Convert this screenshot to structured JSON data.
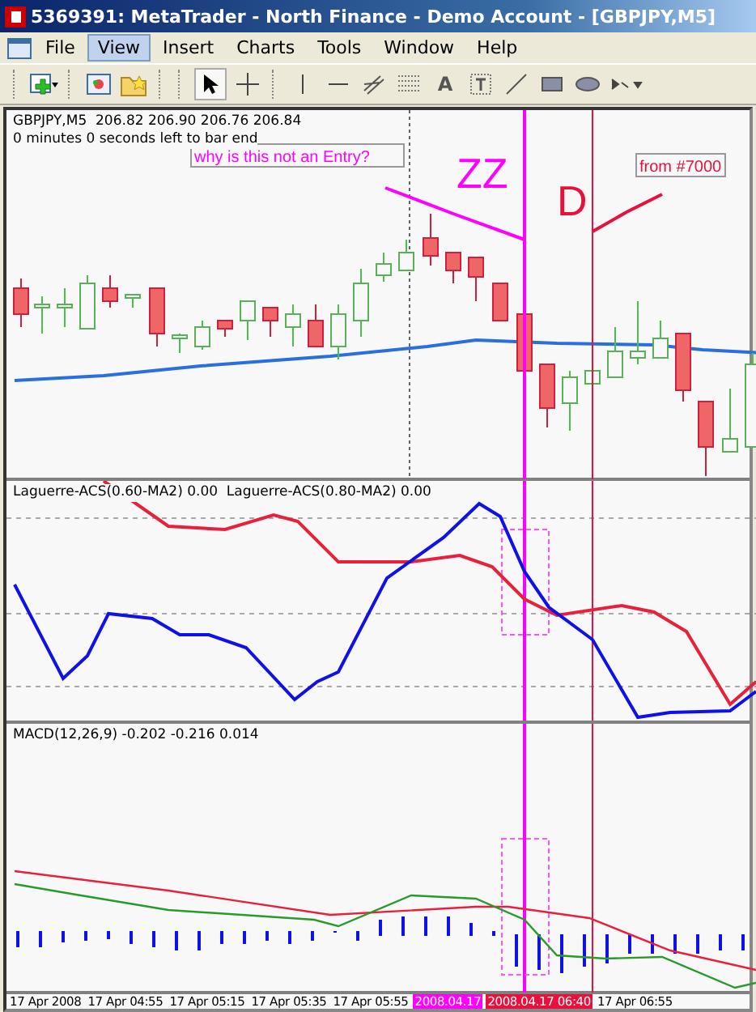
{
  "window": {
    "title": "5369391: MetaTrader - North Finance - Demo Account - [GBPJPY,M5]"
  },
  "menu": [
    {
      "label": "File",
      "selected": false
    },
    {
      "label": "View",
      "selected": true
    },
    {
      "label": "Insert",
      "selected": false
    },
    {
      "label": "Charts",
      "selected": false
    },
    {
      "label": "Tools",
      "selected": false
    },
    {
      "label": "Window",
      "selected": false
    },
    {
      "label": "Help",
      "selected": false
    }
  ],
  "toolbar": {
    "text_tool": "A"
  },
  "chart": {
    "symbol_info": "GBPJPY,M5  206.82 206.90 206.76 206.84",
    "timer": "0 minutes 0 seconds left to bar end",
    "annotations": [
      {
        "kind": "label",
        "text": "why is this not an Entry?",
        "color": "#ff00ff"
      },
      {
        "kind": "big",
        "text": "ZZ",
        "color": "#ff00ff"
      },
      {
        "kind": "big",
        "text": "D",
        "color": "#e8103c"
      },
      {
        "kind": "label",
        "text": "from #7000",
        "color": "#e8103c"
      }
    ]
  },
  "indicators": [
    {
      "label": "Laguerre-ACS(0.60-MA2) 0.00  Laguerre-ACS(0.80-MA2) 0.00"
    },
    {
      "label": "MACD(12,26,9) -0.202 -0.216 0.014"
    }
  ],
  "time_axis": [
    {
      "text": "17 Apr 2008"
    },
    {
      "text": "17 Apr 04:55"
    },
    {
      "text": "17 Apr 05:15"
    },
    {
      "text": "17 Apr 05:35"
    },
    {
      "text": "17 Apr 05:55"
    },
    {
      "text": "2008.04.17",
      "color": "#ff00ff"
    },
    {
      "text": "2008.04.17 06:40",
      "color": "#e8103c"
    },
    {
      "text": "17 Apr 06:55"
    }
  ]
}
